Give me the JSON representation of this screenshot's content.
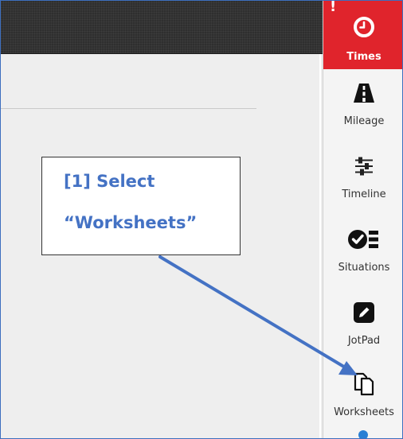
{
  "sidebar": {
    "items": [
      {
        "id": "times",
        "label": "Times",
        "icon": "clock-icon",
        "alert": "!"
      },
      {
        "id": "mileage",
        "label": "Mileage",
        "icon": "road-icon"
      },
      {
        "id": "timeline",
        "label": "Timeline",
        "icon": "sliders-icon"
      },
      {
        "id": "situations",
        "label": "Situations",
        "icon": "checklist-icon"
      },
      {
        "id": "jotpad",
        "label": "JotPad",
        "icon": "pencil-icon"
      },
      {
        "id": "worksheets",
        "label": "Worksheets",
        "icon": "copy-icon"
      }
    ],
    "active_color": "#e0242c"
  },
  "callout": {
    "line1": "[1] Select",
    "line2": "“Worksheets”",
    "color": "#4472c4"
  }
}
